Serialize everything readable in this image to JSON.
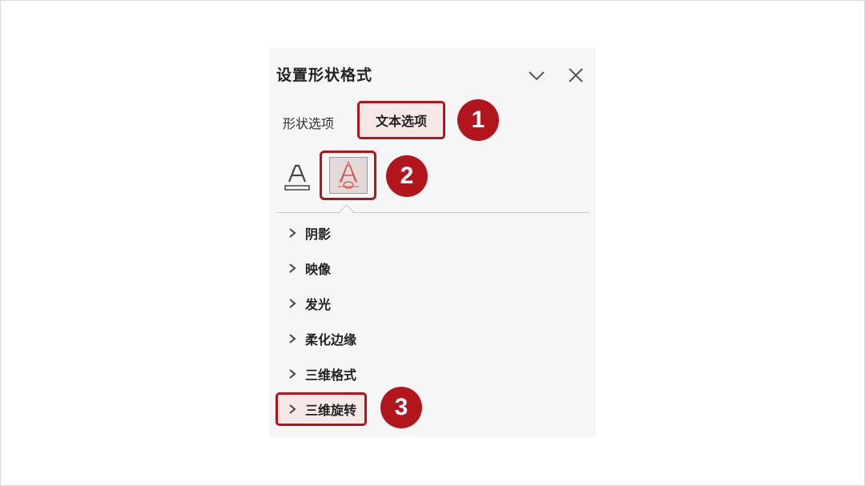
{
  "panel": {
    "title": "设置形状格式",
    "collapse_icon": "chevron-down-icon",
    "close_icon": "close-icon"
  },
  "tabs": [
    {
      "label": "形状选项"
    },
    {
      "label": "文本选项",
      "selected": true
    }
  ],
  "icon_tabs": [
    {
      "icon": "text-fill-outline-icon"
    },
    {
      "icon": "text-effects-icon",
      "selected": true
    }
  ],
  "sections": [
    {
      "label": "阴影"
    },
    {
      "label": "映像"
    },
    {
      "label": "发光"
    },
    {
      "label": "柔化边缘"
    },
    {
      "label": "三维格式"
    },
    {
      "label": "三维旋转",
      "highlighted": true
    }
  ],
  "callouts": [
    "1",
    "2",
    "3"
  ],
  "colors": {
    "accent": "#b3151d",
    "highlight_bg": "#f7e8e8",
    "panel_bg": "#f6f6f6",
    "effects_icon": "#d9534f"
  }
}
